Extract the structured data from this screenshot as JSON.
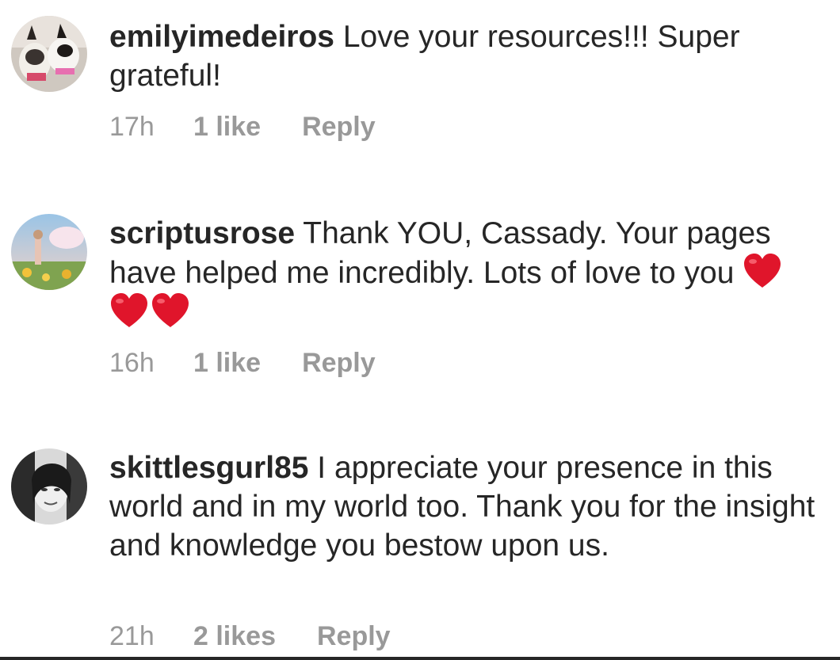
{
  "comments": [
    {
      "username": "emilyimedeiros",
      "text": "Love your resources!!! Super grateful!",
      "time": "17h",
      "likes": "1 like",
      "reply": "Reply"
    },
    {
      "username": "scriptusrose",
      "text": "Thank YOU,  Cassady. Your pages have helped me incredibly. Lots of love to you",
      "emoji": "red-heart x3",
      "time": "16h",
      "likes": "1 like",
      "reply": "Reply"
    },
    {
      "username": "skittlesgurl85",
      "text": "I appreciate your presence in this world and in my world too. Thank you for the insight and knowledge you bestow upon us.",
      "time": "21h",
      "likes": "2 likes",
      "reply": "Reply"
    }
  ],
  "colors": {
    "text": "#262626",
    "meta": "#999999",
    "heart": "#e0152b"
  }
}
